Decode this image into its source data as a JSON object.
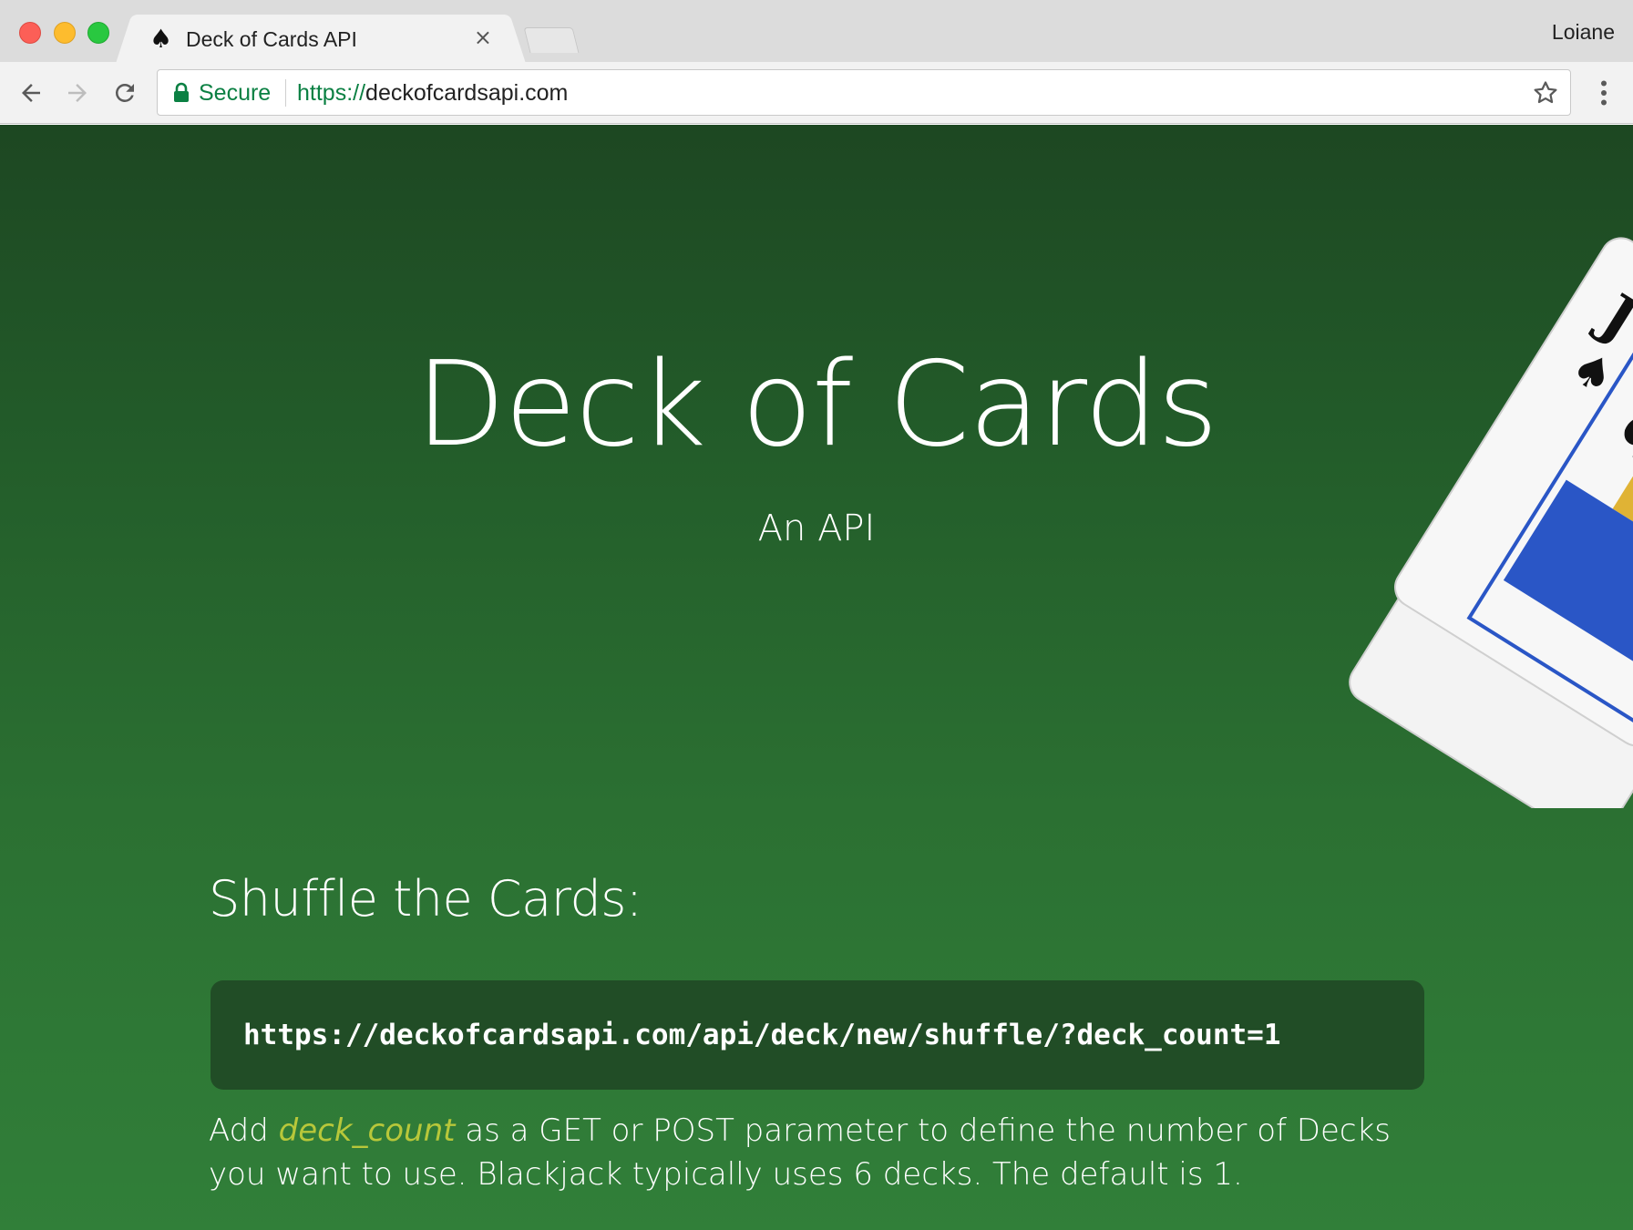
{
  "browser": {
    "tab": {
      "favicon": "♠",
      "title": "Deck of Cards API",
      "close_glyph": "×"
    },
    "profile_name": "Loiane",
    "address_bar": {
      "secure_label": "Secure",
      "url_scheme": "https://",
      "url_host": "deckofcardsapi.com"
    },
    "icons": [
      "back-arrow-icon",
      "forward-arrow-icon",
      "reload-icon",
      "lock-icon",
      "star-icon",
      "more-vert-icon"
    ]
  },
  "hero": {
    "title": "Deck of Cards",
    "subtitle": "An API"
  },
  "shuffle_section": {
    "heading": "Shuffle the Cards:",
    "code": "https://deckofcardsapi.com/api/deck/new/shuffle/?deck_count=1",
    "desc_before": "Add ",
    "desc_param": "deck_count",
    "desc_after": " as a GET or POST parameter to define the number of Decks you want to use. Blackjack typically uses 6 decks. The default is 1."
  },
  "colors": {
    "page_green_top": "#1d4722",
    "page_green_bottom": "#317f39",
    "code_bg": "#214d26",
    "param_highlight": "#b8c73a",
    "secure_green": "#0b8043"
  }
}
